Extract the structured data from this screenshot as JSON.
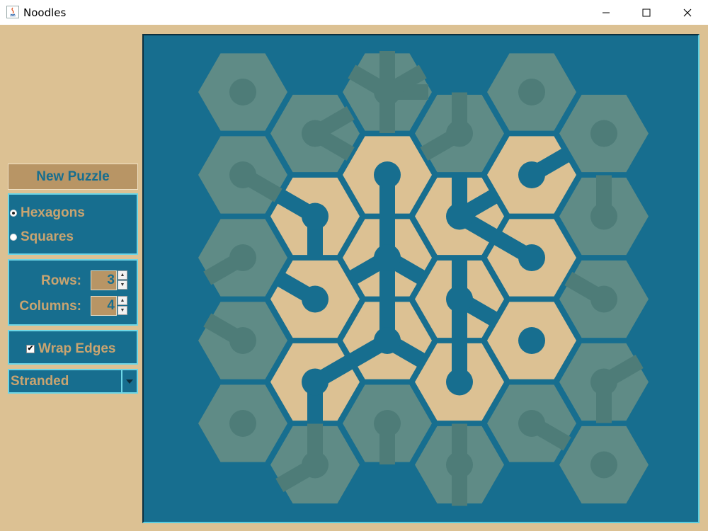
{
  "window": {
    "title": "Noodles"
  },
  "controls": {
    "new_puzzle_label": "New Puzzle",
    "shape_options": [
      {
        "label": "Hexagons",
        "selected": true
      },
      {
        "label": "Squares",
        "selected": false
      }
    ],
    "rows_label": "Rows:",
    "rows_value": "3",
    "columns_label": "Columns:",
    "columns_value": "4",
    "wrap_edges_label": "Wrap Edges",
    "wrap_edges_checked": true,
    "mode_value": "Stranded"
  },
  "colors": {
    "board": "#176e8f",
    "tile_active": "#dcc193",
    "tile_inactive": "#5f8b86",
    "pipe_connected": "#176e8f",
    "pipe_unconnected": "#b89565",
    "pipe_inactive": "#4e7c78",
    "accent": "#6dd6e6"
  },
  "board": {
    "tiles": [
      {
        "col": 0,
        "row": 0,
        "state": "inactive",
        "arms": []
      },
      {
        "col": 1,
        "row": 0,
        "state": "inactive",
        "arms": [
          30,
          330
        ]
      },
      {
        "col": 2,
        "row": 0,
        "state": "inactive",
        "arms": [
          0,
          90,
          210,
          270,
          330
        ]
      },
      {
        "col": 3,
        "row": 0,
        "state": "inactive",
        "arms": [
          150,
          270
        ]
      },
      {
        "col": 4,
        "row": 0,
        "state": "inactive",
        "arms": []
      },
      {
        "col": 5,
        "row": 0,
        "state": "inactive",
        "arms": []
      },
      {
        "col": 0,
        "row": 1,
        "state": "inactive",
        "arms": [
          30
        ]
      },
      {
        "col": 1,
        "row": 1,
        "state": "active",
        "arms": [
          90,
          210
        ]
      },
      {
        "col": 2,
        "row": 1,
        "state": "active",
        "arms": [
          90
        ]
      },
      {
        "col": 3,
        "row": 1,
        "state": "active",
        "arms": [
          270,
          330,
          30
        ]
      },
      {
        "col": 4,
        "row": 1,
        "state": "active",
        "arms": [
          330
        ]
      },
      {
        "col": 5,
        "row": 1,
        "state": "inactive",
        "arms": [
          270
        ]
      },
      {
        "col": 0,
        "row": 2,
        "state": "inactive",
        "arms": [
          150
        ]
      },
      {
        "col": 1,
        "row": 2,
        "state": "active",
        "arms": [
          210
        ]
      },
      {
        "col": 2,
        "row": 2,
        "state": "active",
        "arms": [
          90,
          270,
          30,
          150
        ]
      },
      {
        "col": 3,
        "row": 2,
        "state": "active",
        "arms": [
          270,
          90,
          30
        ]
      },
      {
        "col": 4,
        "row": 2,
        "state": "active",
        "arms": [
          210
        ]
      },
      {
        "col": 5,
        "row": 2,
        "state": "inactive",
        "arms": [
          210
        ]
      },
      {
        "col": 0,
        "row": 3,
        "state": "inactive",
        "arms": [
          210
        ]
      },
      {
        "col": 1,
        "row": 3,
        "state": "active",
        "arms": [
          330,
          90
        ]
      },
      {
        "col": 2,
        "row": 3,
        "state": "active",
        "arms": [
          270,
          150,
          30
        ]
      },
      {
        "col": 3,
        "row": 3,
        "state": "active",
        "arms": [
          270
        ]
      },
      {
        "col": 4,
        "row": 3,
        "state": "active",
        "arms": []
      },
      {
        "col": 5,
        "row": 3,
        "state": "inactive",
        "arms": [
          330,
          90
        ]
      },
      {
        "col": 0,
        "row": 4,
        "state": "inactive",
        "arms": []
      },
      {
        "col": 1,
        "row": 4,
        "state": "inactive",
        "arms": [
          270,
          150
        ]
      },
      {
        "col": 2,
        "row": 4,
        "state": "inactive",
        "arms": [
          90
        ]
      },
      {
        "col": 3,
        "row": 4,
        "state": "inactive",
        "arms": [
          270,
          90
        ]
      },
      {
        "col": 4,
        "row": 4,
        "state": "inactive",
        "arms": [
          30
        ]
      },
      {
        "col": 5,
        "row": 4,
        "state": "inactive",
        "arms": []
      }
    ]
  }
}
